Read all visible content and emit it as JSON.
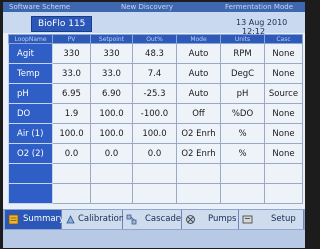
{
  "header": {
    "left_text": "Software Scheme",
    "center_text": "New Discovery",
    "right_text": "Fermentation Mode"
  },
  "unit": {
    "name": "BioFlo 115"
  },
  "datetime": {
    "date": "13 Aug 2010",
    "time": "12:12"
  },
  "table": {
    "columns": [
      "LoopName",
      "PV",
      "Setpoint",
      "Out%",
      "Mode",
      "Units",
      "Casc"
    ],
    "rows": [
      {
        "name": "Agit",
        "pv": "330",
        "setpoint": "330",
        "out": "48.3",
        "mode": "Auto",
        "units": "RPM",
        "casc": "None"
      },
      {
        "name": "Temp",
        "pv": "33.0",
        "setpoint": "33.0",
        "out": "7.4",
        "mode": "Auto",
        "units": "DegC",
        "casc": "None"
      },
      {
        "name": "pH",
        "pv": "6.95",
        "setpoint": "6.90",
        "out": "-25.3",
        "mode": "Auto",
        "units": "pH",
        "casc": "Source"
      },
      {
        "name": "DO",
        "pv": "1.9",
        "setpoint": "100.0",
        "out": "-100.0",
        "mode": "Off",
        "units": "%DO",
        "casc": "None"
      },
      {
        "name": "Air   (1)",
        "pv": "100.0",
        "setpoint": "100.0",
        "out": "100.0",
        "mode": "O2 Enrh",
        "units": "%",
        "casc": "None"
      },
      {
        "name": "O2   (2)",
        "pv": "0.0",
        "setpoint": "0.0",
        "out": "0.0",
        "mode": "O2 Enrh",
        "units": "%",
        "casc": "None"
      }
    ],
    "empty_rows": 2
  },
  "tabs": [
    {
      "label": "Summary",
      "icon": "summary-icon",
      "active": true
    },
    {
      "label": "Calibration",
      "icon": "calibration-icon",
      "active": false
    },
    {
      "label": "Cascade",
      "icon": "cascade-icon",
      "active": false
    },
    {
      "label": "Pumps",
      "icon": "pump-icon",
      "active": false
    },
    {
      "label": "Setup",
      "icon": "setup-icon",
      "active": false
    }
  ]
}
